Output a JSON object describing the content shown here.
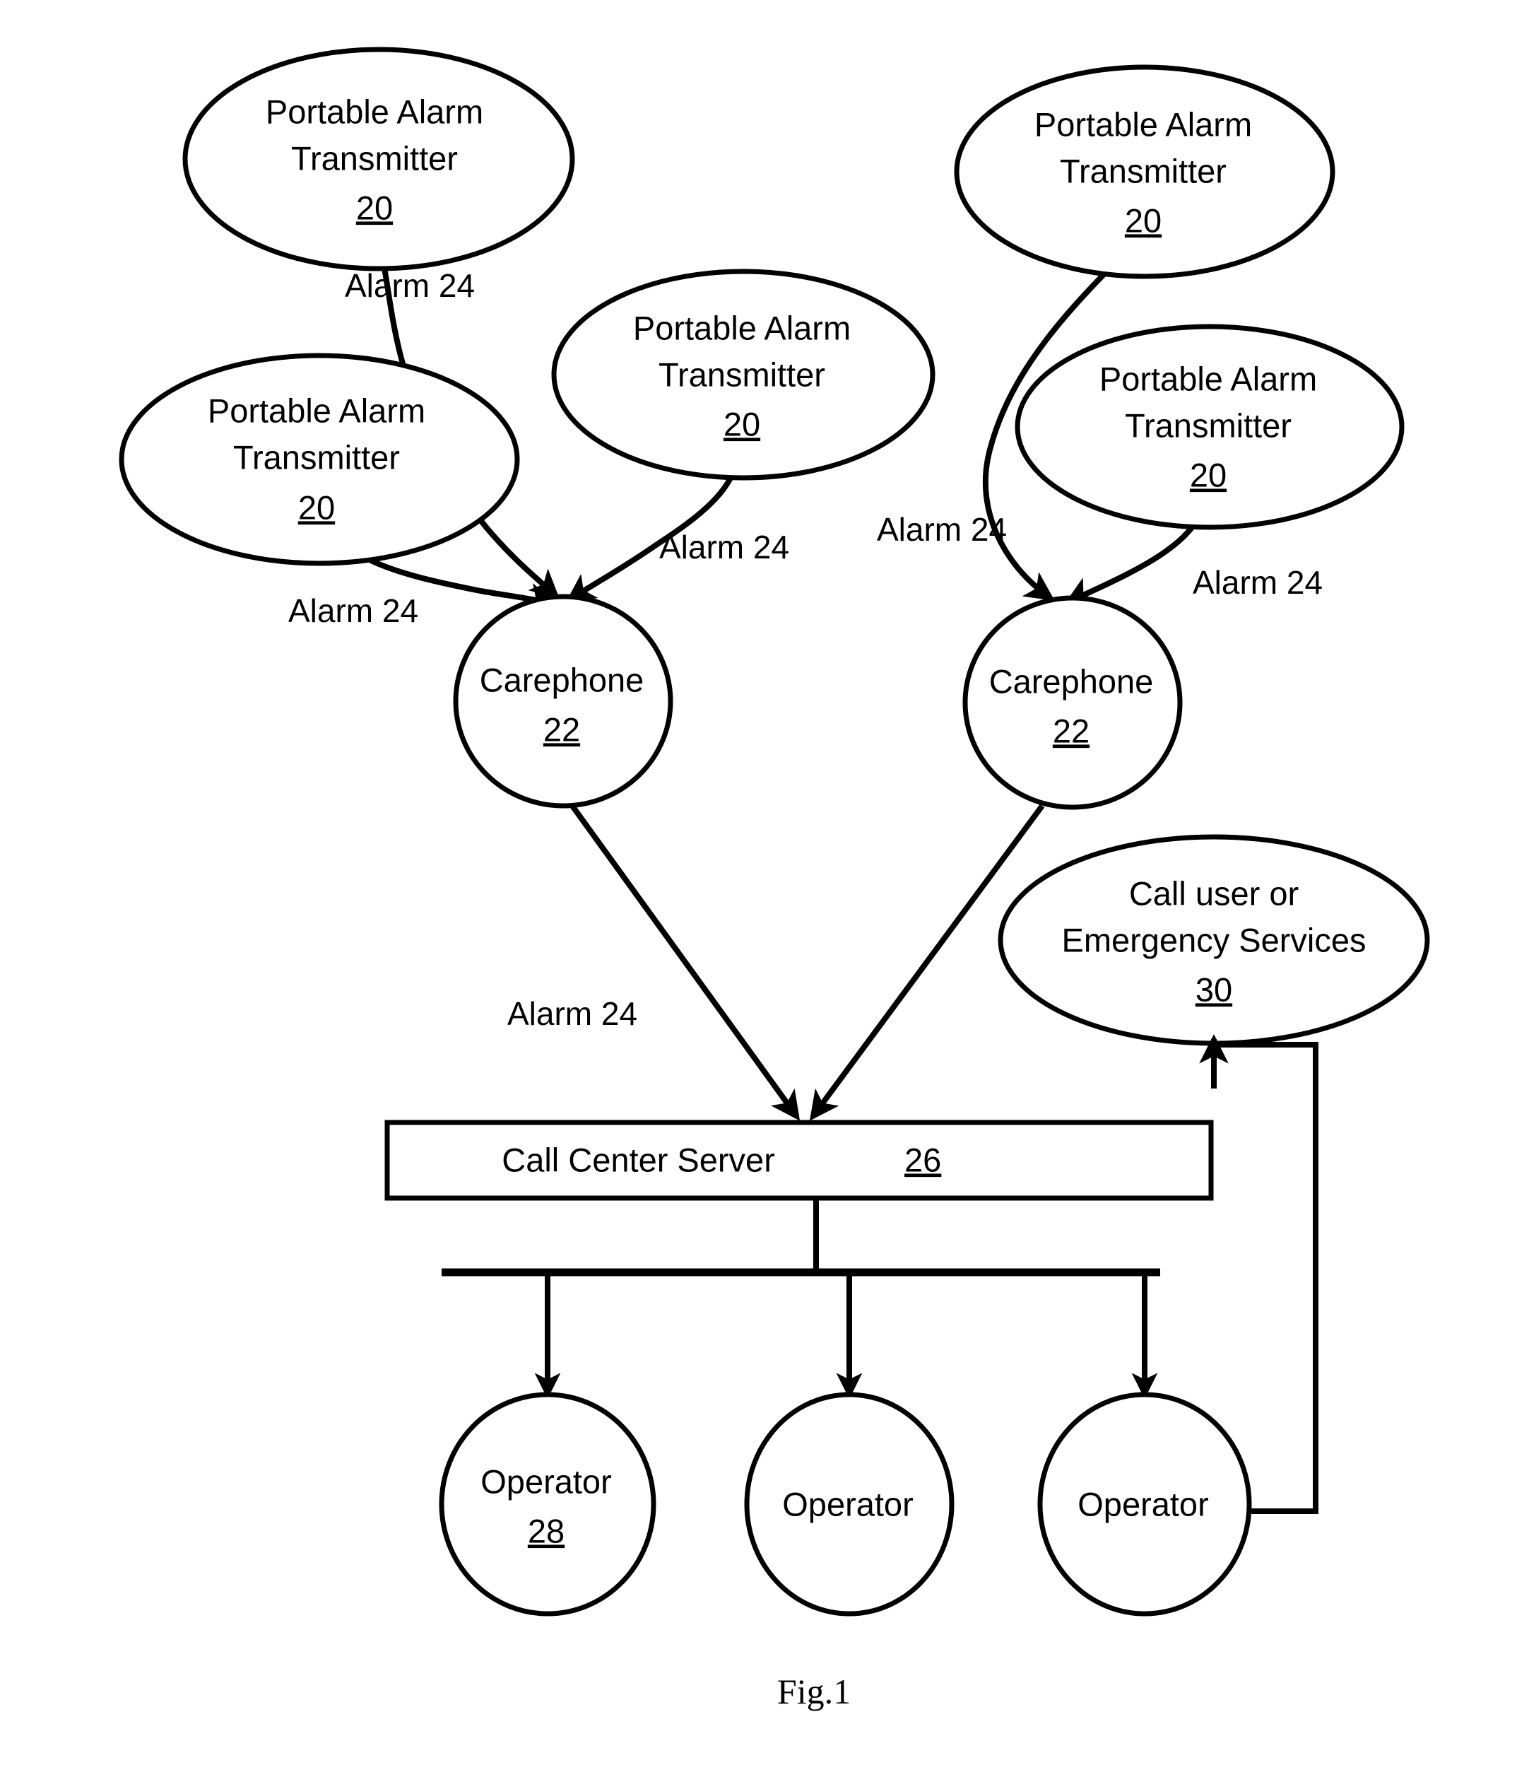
{
  "figure": {
    "caption": "Fig.1"
  },
  "nodes": {
    "transmitters": [
      {
        "id": "pat-1",
        "line1": "Portable Alarm",
        "line2": "Transmitter",
        "ref": "20"
      },
      {
        "id": "pat-2",
        "line1": "Portable Alarm",
        "line2": "Transmitter",
        "ref": "20"
      },
      {
        "id": "pat-3",
        "line1": "Portable Alarm",
        "line2": "Transmitter",
        "ref": "20"
      },
      {
        "id": "pat-4",
        "line1": "Portable Alarm",
        "line2": "Transmitter",
        "ref": "20"
      },
      {
        "id": "pat-5",
        "line1": "Portable Alarm",
        "line2": "Transmitter",
        "ref": "20"
      }
    ],
    "carephones": [
      {
        "id": "carephone-1",
        "label": "Carephone",
        "ref": "22"
      },
      {
        "id": "carephone-2",
        "label": "Carephone",
        "ref": "22"
      }
    ],
    "server": {
      "label": "Call Center Server",
      "ref": "26"
    },
    "operators": [
      {
        "id": "operator-1",
        "label": "Operator",
        "ref": "28"
      },
      {
        "id": "operator-2",
        "label": "Operator",
        "ref": ""
      },
      {
        "id": "operator-3",
        "label": "Operator",
        "ref": ""
      }
    ],
    "emergency": {
      "line1": "Call user or",
      "line2": "Emergency Services",
      "ref": "30"
    }
  },
  "edge_labels": {
    "alarm_top_left": "Alarm 24",
    "alarm_left": "Alarm 24",
    "alarm_center": "Alarm 24",
    "alarm_right_outer": "Alarm 24",
    "alarm_right_inner": "Alarm 24",
    "alarm_to_server": "Alarm 24"
  },
  "colors": {
    "stroke": "#000000",
    "fill": "#ffffff",
    "background": "#ffffff"
  }
}
